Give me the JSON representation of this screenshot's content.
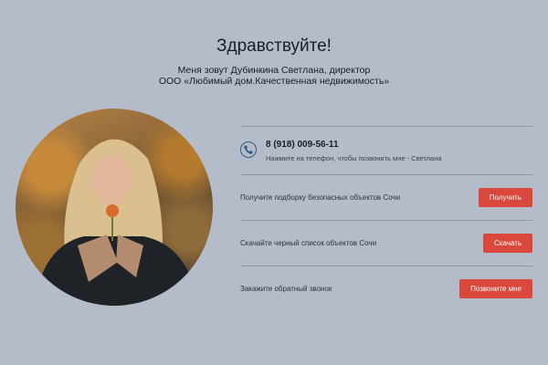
{
  "header": {
    "greeting": "Здравствуйте!",
    "intro_line1": "Меня зовут Дубинкина Светлана, директор",
    "intro_line2": "ООО «Любимый дом.Качественная недвижимость»"
  },
  "contact": {
    "phone": "8 (918) 009-56-11",
    "phone_hint": "Нажмите на телефон, чтобы позвонить мне - Светлана",
    "icon": "phone-icon"
  },
  "actions": [
    {
      "label": "Получите подборку безопасных объектов Сочи",
      "button": "Получить"
    },
    {
      "label": "Скачайте черный список объектов Сочи",
      "button": "Скачать"
    },
    {
      "label": "Закажите обратный звонок",
      "button": "Позвоните мне"
    }
  ],
  "colors": {
    "background": "#b3bcc8",
    "button": "#d9473d",
    "icon": "#2d5b86"
  }
}
